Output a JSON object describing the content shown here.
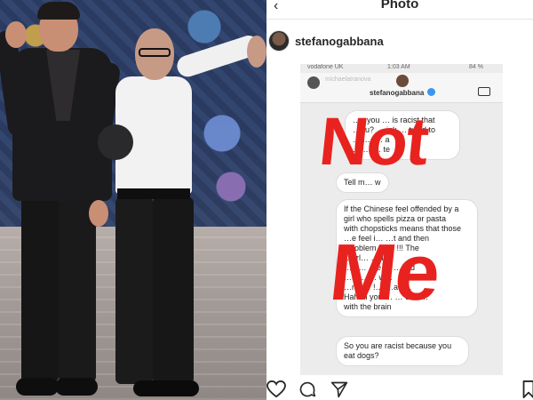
{
  "photo": {
    "description_color_bg": "#2b3f66",
    "runway_color": "#a49c98"
  },
  "header": {
    "title": "Photo",
    "back_glyph": "‹"
  },
  "post": {
    "username": "stefanogabbana"
  },
  "story": {
    "status_carrier": "vodafone UK",
    "status_time": "1:03 AM",
    "status_battery": "84 %",
    "faded_handle": "michaelatranova",
    "handle": "stefanogabbana",
    "bubble1_lines": [
      "…y you … is racist that",
      "…ou? … ink … tupid to",
      "… i… … a",
      "… … … te"
    ],
    "bubble2": "Tell m… w",
    "bubble3_lines": [
      "If the Chinese feel offended by a",
      "girl who spells pizza or pasta",
      "with chopsticks means that those",
      "…e feel i… …t and then",
      "…roblem… … !!! The",
      "…orl… …hat",
      "…at… …e … …and",
      "…d … … w…",
      "…nd … !… …aci…",
      "Hahah you … … com…",
      "with the brain"
    ],
    "bubble4_lines": [
      "So you are racist because you",
      "eat dogs?"
    ]
  },
  "overlay": {
    "word1": "Not",
    "word2": "Me",
    "color": "#e8231f"
  },
  "actions": {
    "like": "heart-icon",
    "comment": "comment-icon",
    "share": "share-icon",
    "save": "bookmark-icon"
  }
}
